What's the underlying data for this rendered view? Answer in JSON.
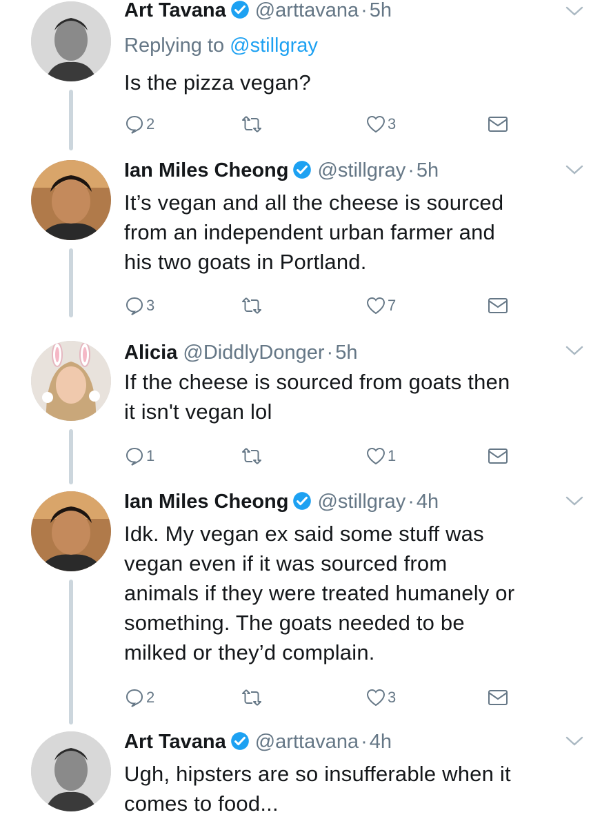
{
  "tweets": [
    {
      "name": "Art Tavana",
      "verified": true,
      "handle": "@arttavana",
      "time": "5h",
      "replying_to_prefix": "Replying to ",
      "replying_to_handle": "@stillgray",
      "text": "Is the pizza vegan?",
      "replies": "2",
      "retweets": "",
      "likes": "3"
    },
    {
      "name": "Ian Miles Cheong",
      "verified": true,
      "handle": "@stillgray",
      "time": "5h",
      "text_lines": [
        "It’s vegan and all the cheese is sourced",
        "from an independent urban farmer and",
        "his two goats in Portland."
      ],
      "replies": "3",
      "retweets": "",
      "likes": "7"
    },
    {
      "name": "Alicia",
      "verified": false,
      "handle": "@DiddlyDonger",
      "time": "5h",
      "text_lines": [
        "If the cheese is sourced from goats then",
        "it isn't vegan lol"
      ],
      "replies": "1",
      "retweets": "",
      "likes": "1"
    },
    {
      "name": "Ian Miles Cheong",
      "verified": true,
      "handle": "@stillgray",
      "time": "4h",
      "text_lines": [
        "Idk. My vegan ex said some stuff was",
        "vegan even if it was sourced from",
        "animals if they were treated humanely or",
        "something. The goats needed to be",
        "milked or they’d complain."
      ],
      "replies": "2",
      "retweets": "",
      "likes": "3"
    },
    {
      "name": "Art Tavana",
      "verified": true,
      "handle": "@arttavana",
      "time": "4h",
      "text_lines": [
        "Ugh, hipsters are so insufferable when it",
        "comes to food..."
      ]
    }
  ],
  "separator": "·",
  "icons": {
    "reply": "reply-icon",
    "retweet": "retweet-icon",
    "like": "heart-icon",
    "dm": "envelope-icon",
    "verified": "verified-badge-icon",
    "more": "chevron-down-icon"
  },
  "colors": {
    "link": "#1da1f2",
    "muted": "#657786",
    "thread": "#ccd6dd"
  }
}
